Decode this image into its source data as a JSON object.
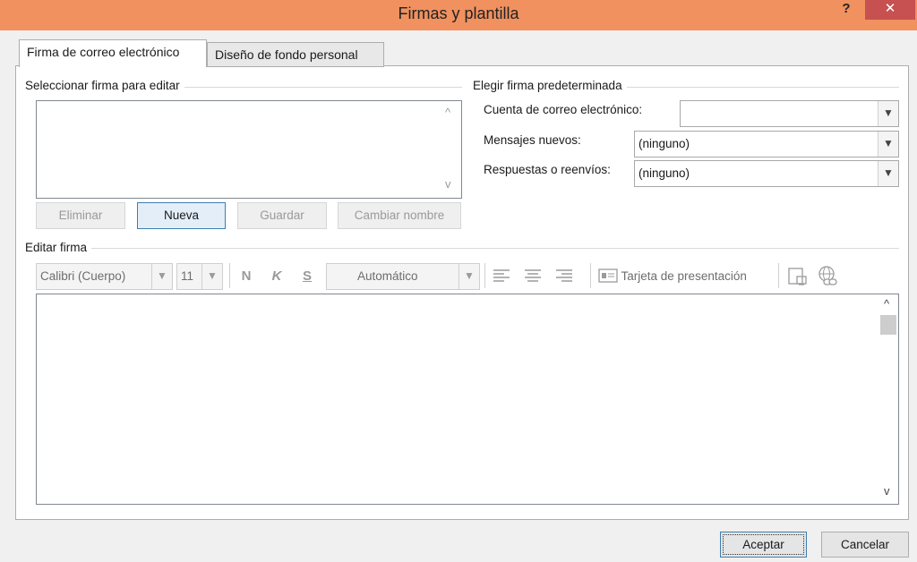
{
  "window": {
    "title": "Firmas y plantilla",
    "help": "?",
    "close": "✕"
  },
  "tabs": [
    {
      "label": "Firma de correo electrónico",
      "active": true
    },
    {
      "label": "Diseño de fondo personal",
      "active": false
    }
  ],
  "select_signature": {
    "label": "Seleccionar firma para editar",
    "scroll_up": "^",
    "scroll_down": "v",
    "buttons": {
      "delete": "Eliminar",
      "new": "Nueva",
      "save": "Guardar",
      "rename": "Cambiar nombre"
    }
  },
  "default_signature": {
    "label": "Elegir firma predeterminada",
    "account_label": "Cuenta de correo electrónico:",
    "account_value": "",
    "new_messages_label": "Mensajes nuevos:",
    "new_messages_value": "(ninguno)",
    "replies_label": "Respuestas o reenvíos:",
    "replies_value": "(ninguno)"
  },
  "edit_signature": {
    "label": "Editar firma",
    "font": "Calibri (Cuerpo)",
    "size": "11",
    "bold": "N",
    "italic": "K",
    "underline": "S",
    "color": "Automático",
    "business_card": "Tarjeta de presentación",
    "scroll_up": "^",
    "scroll_down": "v"
  },
  "footer": {
    "ok": "Aceptar",
    "cancel": "Cancelar"
  },
  "colors": {
    "titlebar": "#f0915f",
    "close": "#c75050",
    "focus_border": "#3c7fb1"
  }
}
